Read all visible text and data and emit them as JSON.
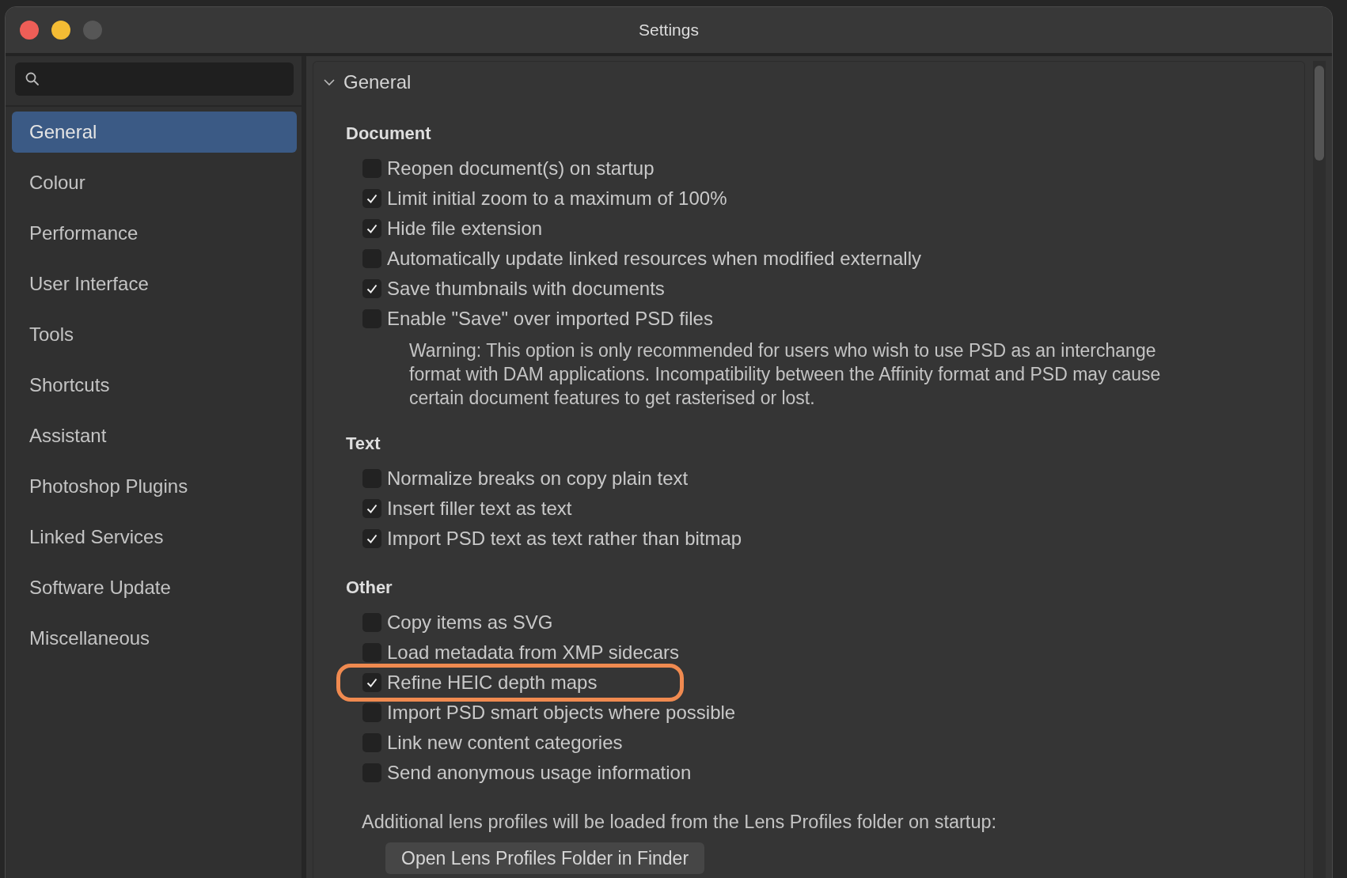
{
  "window": {
    "title": "Settings"
  },
  "sidebar": {
    "items": [
      {
        "label": "General",
        "selected": true
      },
      {
        "label": "Colour",
        "selected": false
      },
      {
        "label": "Performance",
        "selected": false
      },
      {
        "label": "User Interface",
        "selected": false
      },
      {
        "label": "Tools",
        "selected": false
      },
      {
        "label": "Shortcuts",
        "selected": false
      },
      {
        "label": "Assistant",
        "selected": false
      },
      {
        "label": "Photoshop Plugins",
        "selected": false
      },
      {
        "label": "Linked Services",
        "selected": false
      },
      {
        "label": "Software Update",
        "selected": false
      },
      {
        "label": "Miscellaneous",
        "selected": false
      }
    ]
  },
  "section": {
    "title": "General",
    "expanded": true,
    "groups": [
      {
        "title": "Document",
        "options": [
          {
            "label": "Reopen document(s) on startup",
            "checked": false,
            "highlighted": false
          },
          {
            "label": "Limit initial zoom to a maximum of 100%",
            "checked": true,
            "highlighted": false
          },
          {
            "label": "Hide file extension",
            "checked": true,
            "highlighted": false
          },
          {
            "label": "Automatically update linked resources when modified externally",
            "checked": false,
            "highlighted": false
          },
          {
            "label": "Save thumbnails with documents",
            "checked": true,
            "highlighted": false
          },
          {
            "label": "Enable \"Save\" over imported PSD files",
            "checked": false,
            "highlighted": false
          }
        ],
        "note": "Warning: This option is only recommended for users who wish to use PSD as an interchange format with DAM applications. Incompatibility between the Affinity format and PSD may cause certain document features to get rasterised or lost."
      },
      {
        "title": "Text",
        "options": [
          {
            "label": "Normalize breaks on copy plain text",
            "checked": false,
            "highlighted": false
          },
          {
            "label": "Insert filler text as text",
            "checked": true,
            "highlighted": false
          },
          {
            "label": "Import PSD text as text rather than bitmap",
            "checked": true,
            "highlighted": false
          }
        ]
      },
      {
        "title": "Other",
        "options": [
          {
            "label": "Copy items as SVG",
            "checked": false,
            "highlighted": false
          },
          {
            "label": "Load metadata from XMP sidecars",
            "checked": false,
            "highlighted": false
          },
          {
            "label": "Refine HEIC depth maps",
            "checked": true,
            "highlighted": true
          },
          {
            "label": "Import PSD smart objects where possible",
            "checked": false,
            "highlighted": false
          },
          {
            "label": "Link new content categories",
            "checked": false,
            "highlighted": false
          },
          {
            "label": "Send anonymous usage information",
            "checked": false,
            "highlighted": false
          }
        ]
      }
    ],
    "footer_text": "Additional lens profiles will be loaded from the Lens Profiles folder on startup:",
    "button": "Open Lens Profiles Folder in Finder"
  }
}
